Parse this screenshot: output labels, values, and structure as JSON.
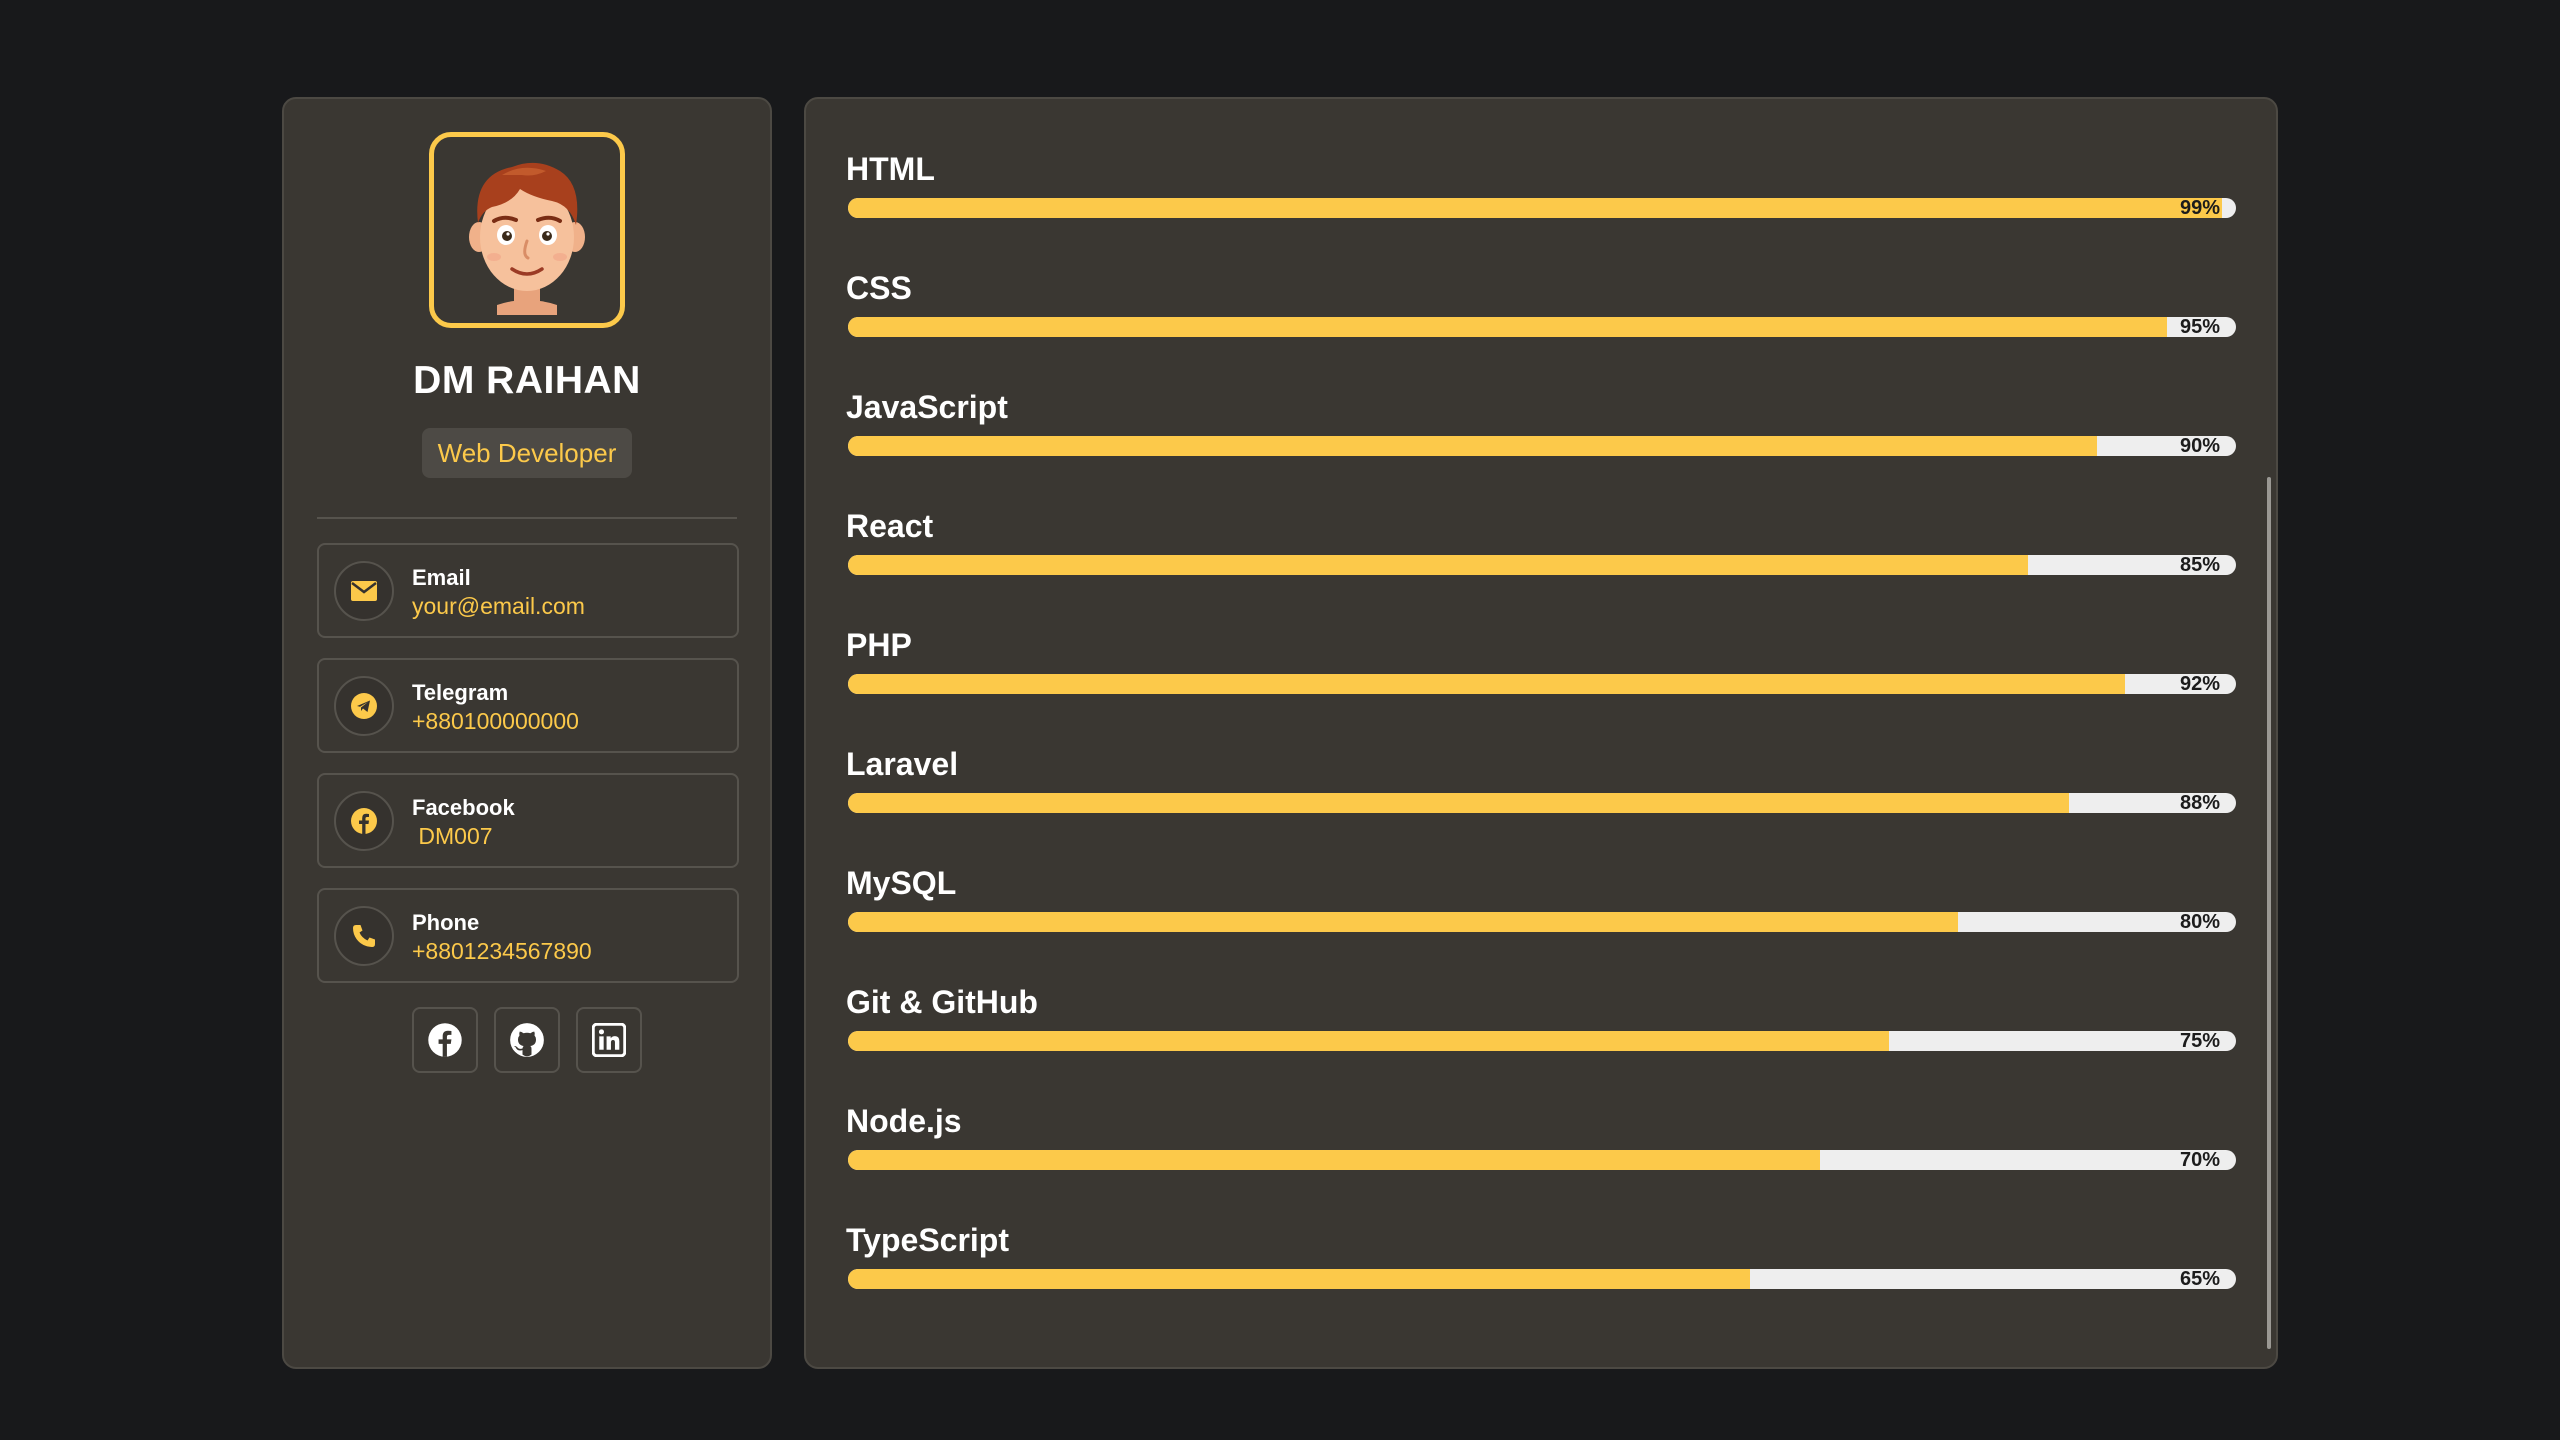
{
  "profile": {
    "name": "DM RAIHAN",
    "role": "Web Developer",
    "contacts": [
      {
        "label": "Email",
        "value": "your@email.com",
        "icon": "envelope-icon"
      },
      {
        "label": "Telegram",
        "value": "+880100000000",
        "icon": "telegram-icon"
      },
      {
        "label": "Facebook",
        "value": " DM007",
        "icon": "facebook-icon"
      },
      {
        "label": "Phone",
        "value": "+8801234567890",
        "icon": "phone-icon"
      }
    ],
    "social": [
      "facebook-icon",
      "github-icon",
      "linkedin-icon"
    ]
  },
  "skills": [
    {
      "name": "HTML",
      "percent": 99,
      "label": "99%"
    },
    {
      "name": "CSS",
      "percent": 95,
      "label": "95%"
    },
    {
      "name": "JavaScript",
      "percent": 90,
      "label": "90%"
    },
    {
      "name": "React",
      "percent": 85,
      "label": "85%"
    },
    {
      "name": "PHP",
      "percent": 92,
      "label": "92%"
    },
    {
      "name": "Laravel",
      "percent": 88,
      "label": "88%"
    },
    {
      "name": "MySQL",
      "percent": 80,
      "label": "80%"
    },
    {
      "name": "Git & GitHub",
      "percent": 75,
      "label": "75%"
    },
    {
      "name": "Node.js",
      "percent": 70,
      "label": "70%"
    },
    {
      "name": "TypeScript",
      "percent": 65,
      "label": "65%"
    }
  ],
  "colors": {
    "accent": "#fcc94a",
    "card": "#3a3732",
    "background": "#18191b",
    "track": "#eeeeee"
  }
}
